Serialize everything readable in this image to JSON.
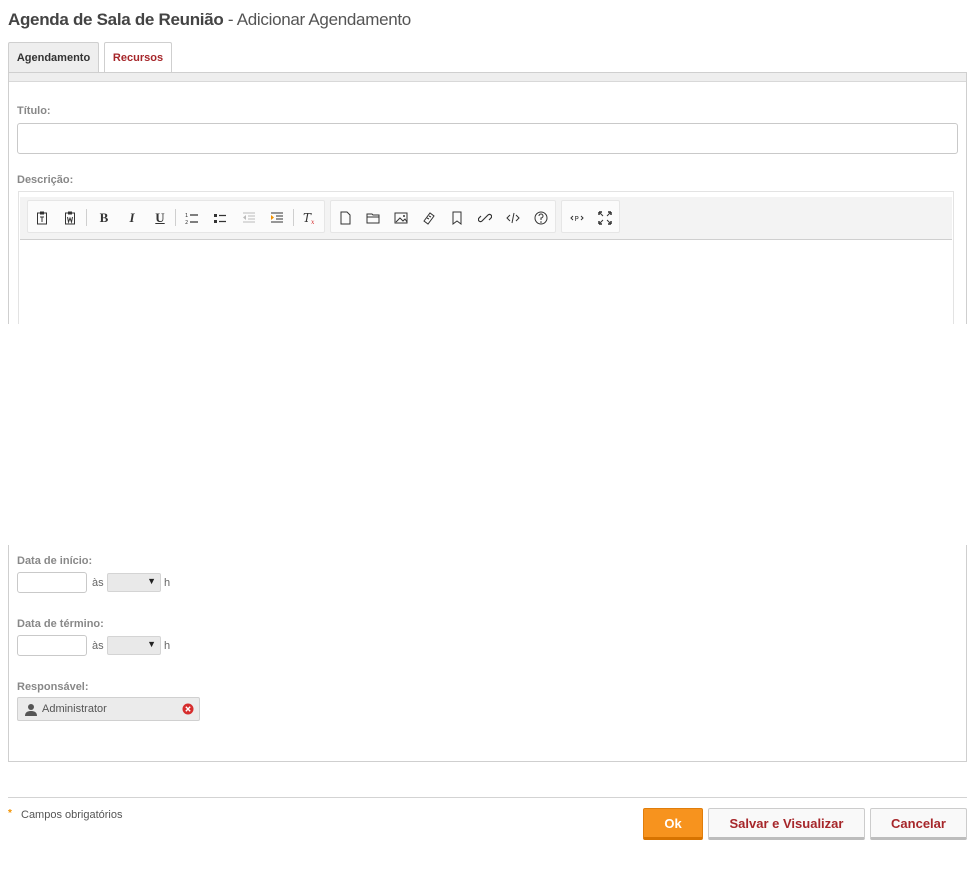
{
  "header": {
    "title": "Agenda de Sala de Reunião",
    "separator": " - ",
    "subtitle": "Adicionar Agendamento"
  },
  "tabs": [
    {
      "label": "Agendamento",
      "active": true
    },
    {
      "label": "Recursos",
      "active": false
    }
  ],
  "form": {
    "title_label": "Título:",
    "title_value": "",
    "description_label": "Descrição:",
    "editor_toolbar": {
      "group1": [
        "paste-text-icon",
        "paste-word-icon",
        "bold-icon",
        "italic-icon",
        "underline-icon",
        "numbered-list-icon",
        "bulleted-list-icon",
        "outdent-icon",
        "indent-icon",
        "remove-format-icon"
      ],
      "group2": [
        "new-page-icon",
        "open-folder-icon",
        "image-icon",
        "horizontal-rule-icon",
        "anchor-icon",
        "link-icon",
        "source-code-icon",
        "special-char-icon"
      ],
      "group3": [
        "source-icon",
        "maximize-icon"
      ],
      "bold_glyph": "B",
      "italic_glyph": "I",
      "underline_glyph": "U"
    },
    "start_date_label": "Data de início:",
    "end_date_label": "Data de término:",
    "at_text": "às",
    "hour_suffix": "h",
    "start_date_value": "",
    "end_date_value": "",
    "start_time_value": "",
    "end_time_value": "",
    "responsible_label": "Responsável:",
    "responsible_name": "Administrator"
  },
  "footer": {
    "required_mark": "*",
    "required_text": "Campos obrigatórios",
    "ok_label": "Ok",
    "save_view_label": "Salvar e Visualizar",
    "cancel_label": "Cancelar"
  },
  "colors": {
    "accent_orange": "#f7931e",
    "link_red": "#a6262a",
    "remove_red": "#d62d2d"
  }
}
